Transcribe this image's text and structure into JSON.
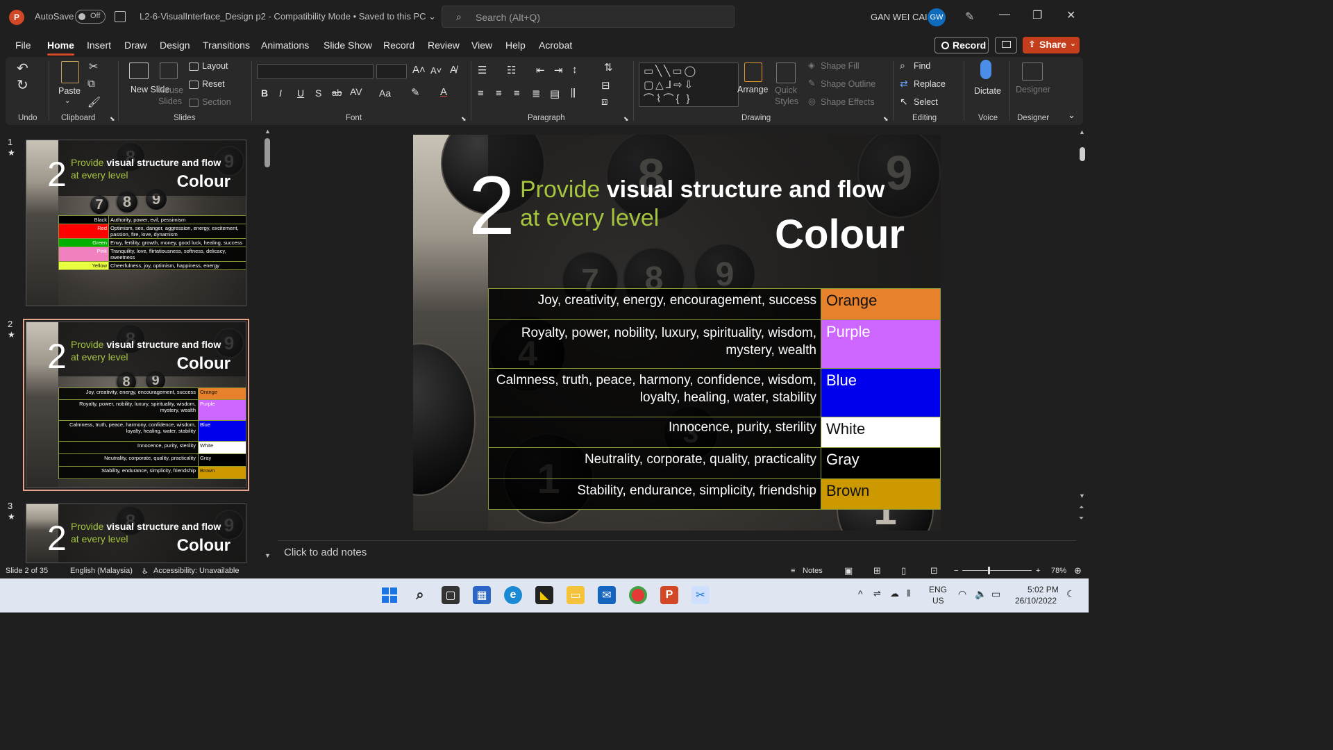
{
  "titlebar": {
    "app_letter": "P",
    "autosave_label": "AutoSave",
    "autosave_state": "Off",
    "document_title": "L2-6-VisualInterface_Design p2  -  Compatibility Mode  •  Saved to this PC ⌄",
    "search_placeholder": "Search (Alt+Q)",
    "user_name": "GAN WEI CAI",
    "user_initials": "GW"
  },
  "menu": {
    "tabs": [
      "File",
      "Home",
      "Insert",
      "Draw",
      "Design",
      "Transitions",
      "Animations",
      "Slide Show",
      "Record",
      "Review",
      "View",
      "Help",
      "Acrobat"
    ],
    "active_tab": "Home",
    "record_label": "Record",
    "share_label": "Share"
  },
  "ribbon": {
    "undo_group": "Undo",
    "clipboard_group": "Clipboard",
    "paste_label": "Paste",
    "slides_group": "Slides",
    "new_slide_label": "New Slide",
    "reuse_slides_label": "Reuse Slides",
    "layout_label": "Layout",
    "reset_label": "Reset",
    "section_label": "Section",
    "font_group": "Font",
    "paragraph_group": "Paragraph",
    "drawing_group": "Drawing",
    "arrange_label": "Arrange",
    "quick_styles_label": "Quick Styles",
    "shape_fill_label": "Shape Fill",
    "shape_outline_label": "Shape Outline",
    "shape_effects_label": "Shape Effects",
    "editing_group": "Editing",
    "find_label": "Find",
    "replace_label": "Replace",
    "select_label": "Select",
    "voice_group": "Voice",
    "dictate_label": "Dictate",
    "designer_group": "Designer",
    "designer_label": "Designer"
  },
  "thumbnails": [
    {
      "number": "1",
      "title_green": "Provide ",
      "title_bold": "visual structure and flow",
      "title_green2": "at every level",
      "heading": "Colour",
      "rows": [
        {
          "name": "Black",
          "desc": "Authority, power, evil, pessimism",
          "color": "#000000",
          "text": "#ffffff"
        },
        {
          "name": "Red",
          "desc": "Optimism, sex, danger, aggression, energy, excitement, passion, fire, love, dynamism",
          "color": "#ff0000",
          "text": "#ffffff"
        },
        {
          "name": "Green",
          "desc": "Envy, fertility, growth, money, good luck, healing, success",
          "color": "#00b000",
          "text": "#ffffff"
        },
        {
          "name": "Pink",
          "desc": "Tranquility, love, flirtatiousness, softness, delicacy, sweetness",
          "color": "#f080c0",
          "text": "#ffffff"
        },
        {
          "name": "Yellow",
          "desc": "Cheerfulness, joy, optimism, happiness, energy",
          "color": "#e8ff40",
          "text": "#000000"
        }
      ]
    },
    {
      "number": "2",
      "title_green": "Provide ",
      "title_bold": "visual structure and flow",
      "title_green2": "at every level",
      "heading": "Colour"
    },
    {
      "number": "3",
      "title_green": "Provide ",
      "title_bold": "visual structure and flow",
      "title_green2": "at every level",
      "heading": "Colour"
    }
  ],
  "slide": {
    "big_number": "2",
    "title_green": "Provide ",
    "title_bold": "visual structure and flow",
    "title_green2": "at every level",
    "heading": "Colour",
    "rows": [
      {
        "desc": "Joy, creativity, energy, encouragement, success",
        "name": "Orange",
        "color": "#e8812c",
        "text": "#111111"
      },
      {
        "desc": "Royalty, power, nobility, luxury, spirituality, wisdom, mystery, wealth",
        "name": "Purple",
        "color": "#cc66ff",
        "text": "#ffffff"
      },
      {
        "desc": "Calmness, truth, peace, harmony, confidence, wisdom, loyalty, healing, water, stability",
        "name": "Blue",
        "color": "#0000ee",
        "text": "#ffffff"
      },
      {
        "desc": "Innocence, purity, sterility",
        "name": "White",
        "color": "#ffffff",
        "text": "#111111"
      },
      {
        "desc": "Neutrality, corporate, quality, practicality",
        "name": "Gray",
        "color": "#000000",
        "text": "#ffffff"
      },
      {
        "desc": "Stability, endurance, simplicity, friendship",
        "name": "Brown",
        "color": "#cc9900",
        "text": "#111111"
      }
    ]
  },
  "notes_placeholder": "Click to add notes",
  "status": {
    "slide_counter": "Slide 2 of 35",
    "language": "English (Malaysia)",
    "accessibility": "Accessibility: Unavailable",
    "notes_label": "Notes",
    "zoom": "78%"
  },
  "taskbar": {
    "lang_top": "ENG",
    "lang_bottom": "US",
    "time": "5:02 PM",
    "date": "26/10/2022"
  }
}
